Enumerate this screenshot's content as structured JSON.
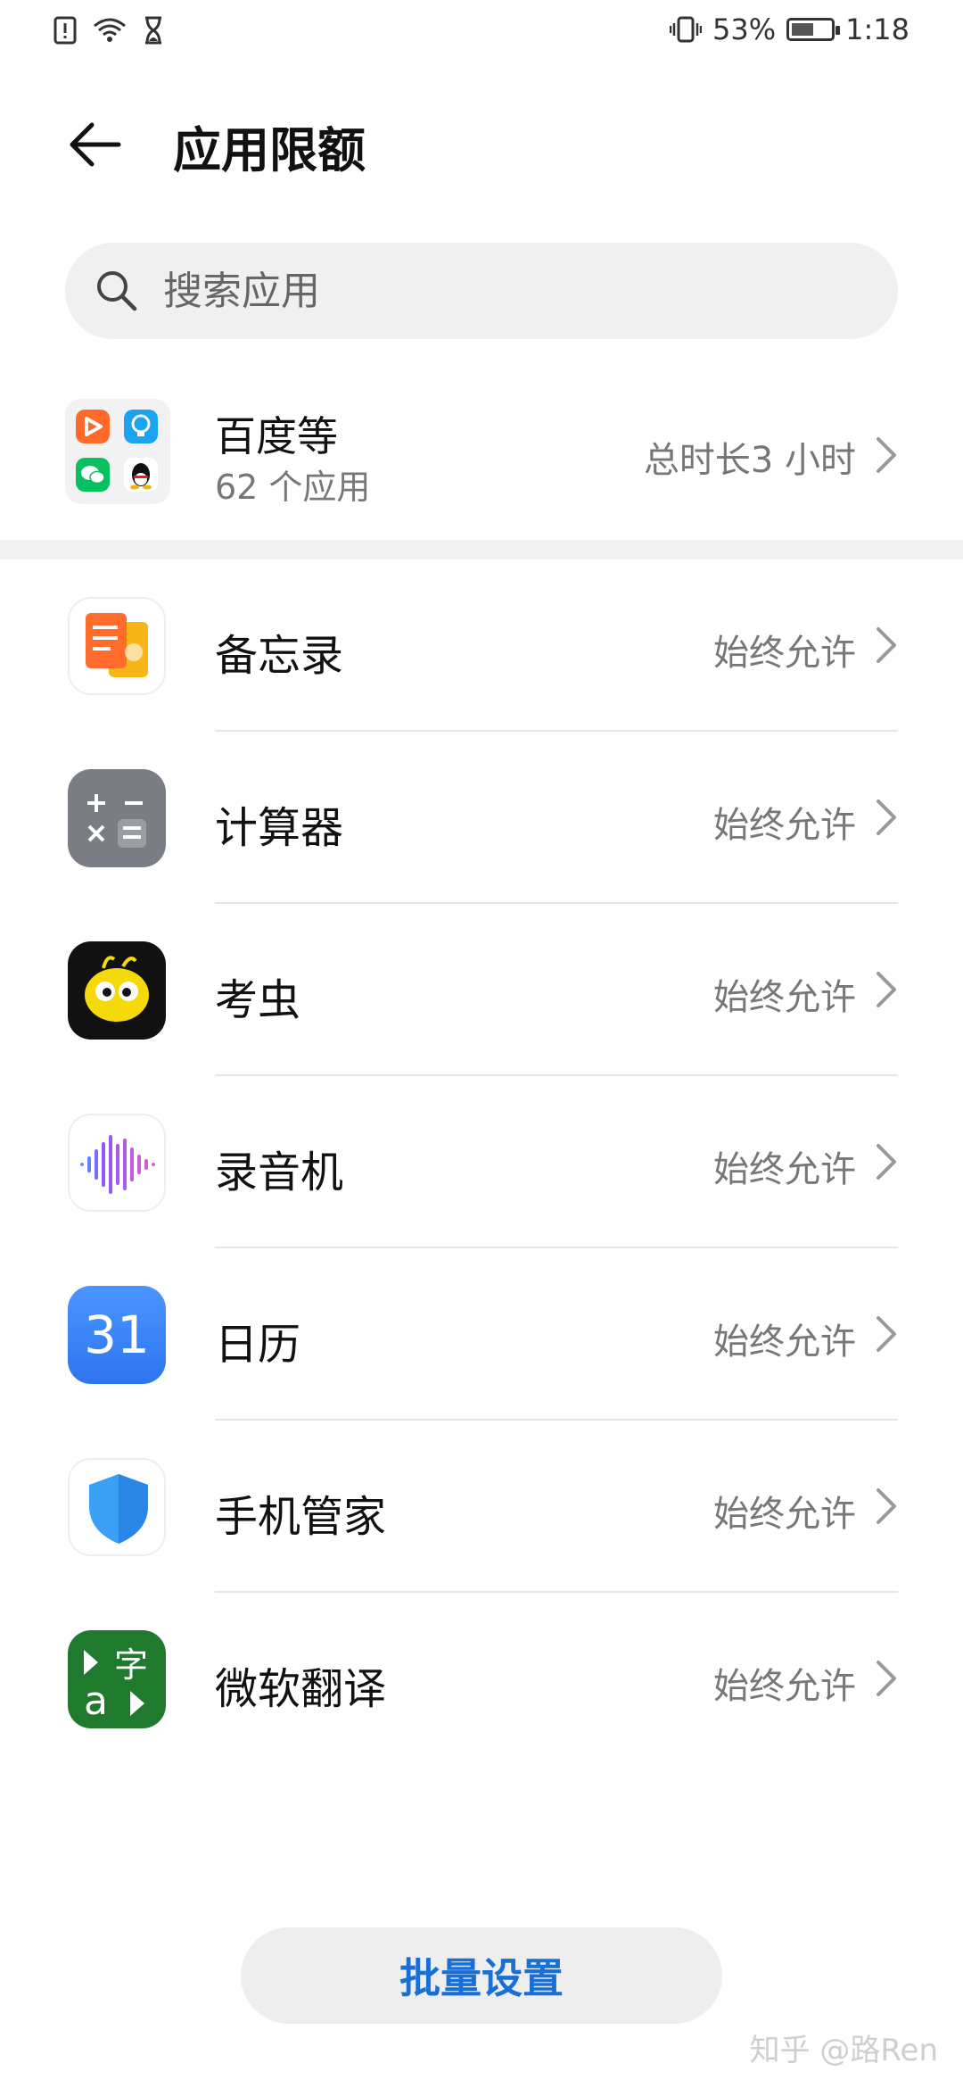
{
  "status_bar": {
    "battery": "53%",
    "time": "1:18"
  },
  "header": {
    "title": "应用限额"
  },
  "search": {
    "placeholder": "搜索应用"
  },
  "group": {
    "title": "百度等",
    "subtitle": "62 个应用",
    "total": "总时长3 小时"
  },
  "apps": [
    {
      "name": "备忘录",
      "status": "始终允许",
      "icon": "notes-icon"
    },
    {
      "name": "计算器",
      "status": "始终允许",
      "icon": "calculator-icon"
    },
    {
      "name": "考虫",
      "status": "始终允许",
      "icon": "kaochong-icon"
    },
    {
      "name": "录音机",
      "status": "始终允许",
      "icon": "recorder-icon"
    },
    {
      "name": "日历",
      "status": "始终允许",
      "icon": "calendar-icon",
      "icon_text": "31"
    },
    {
      "name": "手机管家",
      "status": "始终允许",
      "icon": "phone-manager-icon"
    },
    {
      "name": "微软翻译",
      "status": "始终允许",
      "icon": "microsoft-translator-icon",
      "icon_text": "字"
    }
  ],
  "bottom": {
    "batch_button": "批量设置"
  },
  "watermark": "知乎 @路Ren",
  "colors": {
    "accent": "#1a6fd6",
    "secondary_text": "#777777",
    "divider": "#e6e6e6"
  }
}
